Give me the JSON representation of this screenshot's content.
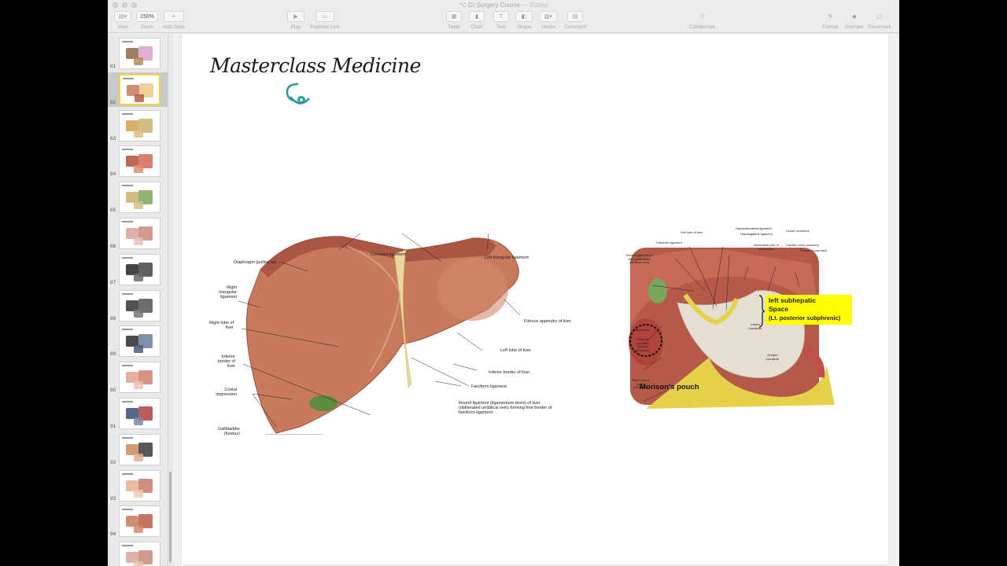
{
  "window": {
    "title": "GI Surgery Course",
    "title_suffix": "— Edited"
  },
  "toolbar": {
    "view_label": "View",
    "zoom_value": "150%",
    "zoom_label": "Zoom",
    "add_slide_label": "Add Slide",
    "play_label": "Play",
    "keynote_live_label": "Keynote Live",
    "table_label": "Table",
    "chart_label": "Chart",
    "text_label": "Text",
    "shape_label": "Shape",
    "media_label": "Media",
    "comment_label": "Comment",
    "collaborate_label": "Collaborate",
    "format_label": "Format",
    "animate_label": "Animate",
    "document_label": "Document",
    "icons": [
      "view-icon",
      "add-slide-icon",
      "play-icon",
      "keynote-live-icon",
      "table-icon",
      "chart-icon",
      "text-icon",
      "shape-icon",
      "media-icon",
      "comment-icon",
      "collaborate-icon",
      "format-icon",
      "animate-icon",
      "document-icon"
    ]
  },
  "sidebar": {
    "slides": [
      {
        "number": "81",
        "selected": false
      },
      {
        "number": "82",
        "selected": true
      },
      {
        "number": "83",
        "selected": false
      },
      {
        "number": "84",
        "selected": false
      },
      {
        "number": "85",
        "selected": false
      },
      {
        "number": "86",
        "selected": false
      },
      {
        "number": "87",
        "selected": false
      },
      {
        "number": "88",
        "selected": false
      },
      {
        "number": "89",
        "selected": false
      },
      {
        "number": "90",
        "selected": false
      },
      {
        "number": "91",
        "selected": false
      },
      {
        "number": "92",
        "selected": false
      },
      {
        "number": "93",
        "selected": false
      },
      {
        "number": "94",
        "selected": false
      },
      {
        "number": "95",
        "selected": false
      }
    ]
  },
  "slide": {
    "brand": "Masterclass Medicine",
    "liver_labels": {
      "diaphragm": "Diaphragm (pulled up)",
      "coronary": "Coronary ligament",
      "left_triangular": "Left triangular ligament",
      "right_triangular": "Right triangular ligament",
      "right_lobe": "Right lobe of liver",
      "fibrous_appendix": "Fibrous appendix of liver",
      "inferior_border_right": "Inferior border of liver",
      "left_lobe": "Left lobe of liver",
      "inferior_border_left": "Inferior border of liver",
      "colic_impression": "Costal impression",
      "falciform": "Falciform ligament",
      "round_ligament": "Round ligament (ligamentum teres) of liver (obliterated umbilical vein) forming free border of falciform ligament",
      "gallbladder": "Gallbladder (fundus)"
    },
    "stomach_labels": {
      "hepatoduodenal": "Hepatoduodenal ligament",
      "hepatogastric": "Hepatogastric ligament",
      "lesser_omentum": "Lesser omentum",
      "left_lobe": "Left lobe of liver",
      "falciform": "Falciform ligament",
      "abdominal_esophagus": "Abdominal part of esophagus",
      "cardiac_notch": "Cardiac notch (incisure)",
      "fundus": "Fundus of stomach",
      "round_ligament": "Round ligament of liver (obliterated umbilical vein)",
      "gallbladder": "Gallbladder",
      "omental_foramen": "Omental (epiploic) foramen (Winslow)",
      "lesser_curvature": "Lesser curvature",
      "greater_curvature": "Greater curvature",
      "right_kidney": "Right kidney (retro-peritoneal)"
    },
    "callout": {
      "line1": "left subhepatic",
      "line2": "Space",
      "line3": "(Lt. posterior subphrenic)"
    },
    "morison": "Morison's pouch"
  },
  "colors": {
    "liver": "#c77a5c",
    "liver_dark": "#9e4f3a",
    "gallbladder": "#5d8a3c",
    "fat": "#e6d24a",
    "callout_bg": "#ffff00",
    "selected_thumb": "#f4d23c",
    "steth": "#2a9a9a"
  }
}
